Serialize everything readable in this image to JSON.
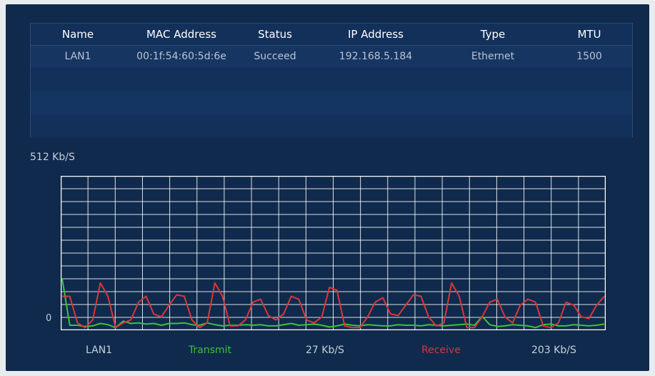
{
  "table": {
    "headers": [
      "Name",
      "MAC Address",
      "Status",
      "IP Address",
      "Type",
      "MTU"
    ],
    "rows": [
      [
        "LAN1",
        "00:1f:54:60:5d:6e",
        "Succeed",
        "192.168.5.184",
        "Ethernet",
        "1500"
      ]
    ]
  },
  "chart_data": {
    "type": "line",
    "ylabel": "512 Kb/S",
    "y_zero_label": "0",
    "ylim": [
      0,
      512
    ],
    "grid": true,
    "series": [
      {
        "name": "Transmit",
        "color": "#3ec13a",
        "values": [
          170,
          12,
          12,
          8,
          10,
          18,
          14,
          4,
          26,
          18,
          20,
          16,
          18,
          12,
          18,
          18,
          20,
          14,
          12,
          20,
          14,
          10,
          12,
          12,
          14,
          12,
          14,
          10,
          10,
          14,
          18,
          12,
          14,
          16,
          12,
          6,
          10,
          16,
          12,
          10,
          14,
          12,
          10,
          10,
          14,
          12,
          12,
          10,
          14,
          12,
          10,
          12,
          14,
          16,
          12,
          42,
          14,
          8,
          10,
          14,
          12,
          10,
          4,
          14,
          16,
          10,
          10,
          14,
          12,
          10,
          12,
          16
        ]
      },
      {
        "name": "Receive",
        "color": "#d9373c",
        "values": [
          110,
          110,
          20,
          4,
          30,
          155,
          110,
          4,
          20,
          30,
          90,
          110,
          50,
          40,
          80,
          115,
          110,
          30,
          4,
          20,
          155,
          110,
          10,
          10,
          30,
          90,
          100,
          45,
          30,
          50,
          110,
          100,
          30,
          20,
          40,
          140,
          130,
          10,
          4,
          4,
          40,
          90,
          105,
          50,
          45,
          80,
          115,
          110,
          40,
          10,
          20,
          155,
          110,
          4,
          4,
          40,
          90,
          100,
          40,
          20,
          80,
          100,
          90,
          10,
          4,
          20,
          90,
          80,
          40,
          35,
          80,
          110
        ]
      }
    ]
  },
  "footer": {
    "interface": "LAN1",
    "transmit_label": "Transmit",
    "transmit_value": "27 Kb/S",
    "receive_label": "Receive",
    "receive_value": "203 Kb/S"
  }
}
